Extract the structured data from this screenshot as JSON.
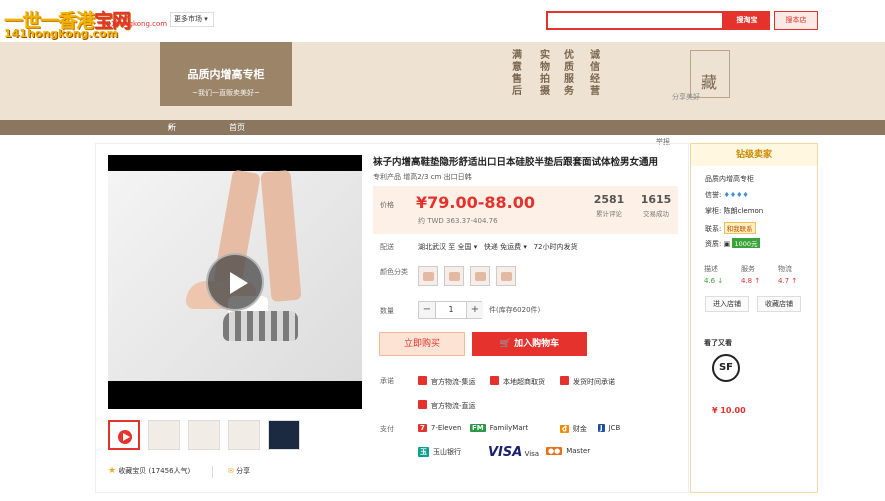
{
  "header": {
    "logo_line1": "一世一香港",
    "logo_line1_accent": "宝网",
    "logo_line2": "141hongkong.com",
    "logo_small": "141hongkong.com",
    "market_dropdown": "更多市场",
    "search_button": "搜淘宝",
    "shop_search_button": "搜本店"
  },
  "banner": {
    "shop_title": "品质内增高专柜",
    "shop_slogan": "~我们一直贩卖美好~",
    "slogans": [
      "满意售后",
      "实物拍摄",
      "优质服务",
      "诚信经营"
    ],
    "collect_char": "藏",
    "share_label": "分享美好"
  },
  "nav": {
    "items": [
      "所有分类",
      "首页"
    ]
  },
  "report_label": "举报",
  "product": {
    "title": "袜子内增高鞋垫隐形舒适出口日本硅胶半垫后跟套面试体检男女通用",
    "subtitle": "专利产品 增高2/3 cm 出口日韩",
    "price_label": "价格",
    "price": "¥79.00-88.00",
    "twd": "约 TWD 363.37-404.76",
    "reviews_count": "2581",
    "reviews_label": "累计评论",
    "sales_count": "1615",
    "sales_label": "交易成功",
    "delivery_label": "配送",
    "delivery_from": "湖北武汉 至",
    "delivery_to": "全国",
    "delivery_method": "快递 免运费",
    "delivery_time": "72小时内发货",
    "color_label": "颜色分类",
    "qty_label": "数量",
    "qty_value": "1",
    "qty_minus": "−",
    "qty_plus": "+",
    "stock": "件(库存6020件)",
    "buy_now": "立即购买",
    "add_to_cart": "加入购物车",
    "promise_label": "承诺",
    "promises": [
      "官方物流-集运",
      "本地超商取货",
      "发货时间承诺",
      "官方物流-直运"
    ],
    "payment_label": "支付",
    "payments": [
      "7-Eleven",
      "FamilyMart",
      "财金",
      "JCB",
      "玉山银行",
      "Visa",
      "Master"
    ],
    "favorite": "收藏宝贝 (17456人气)",
    "share": "分享"
  },
  "seller": {
    "level": "钻级卖家",
    "shop_name": "品质内增高专柜",
    "credit_label": "信誉:",
    "credit_diamonds": "♦♦♦♦",
    "owner_label": "掌柜:",
    "owner_name": "陈朗clemon",
    "contact_label": "联系:",
    "contact_button": "和我联系",
    "qual_label": "资质:",
    "deposit": "1000元",
    "ratings": [
      {
        "label": "描述",
        "value": "4.6",
        "arrow": "↓"
      },
      {
        "label": "服务",
        "value": "4.8",
        "arrow": "↑"
      },
      {
        "label": "物流",
        "value": "4.7",
        "arrow": "↑"
      }
    ],
    "enter_shop": "进入店铺",
    "collect_shop": "收藏店铺",
    "also_viewed": "看了又看",
    "also_item_logo": "SF",
    "also_item_price": "¥ 10.00"
  }
}
